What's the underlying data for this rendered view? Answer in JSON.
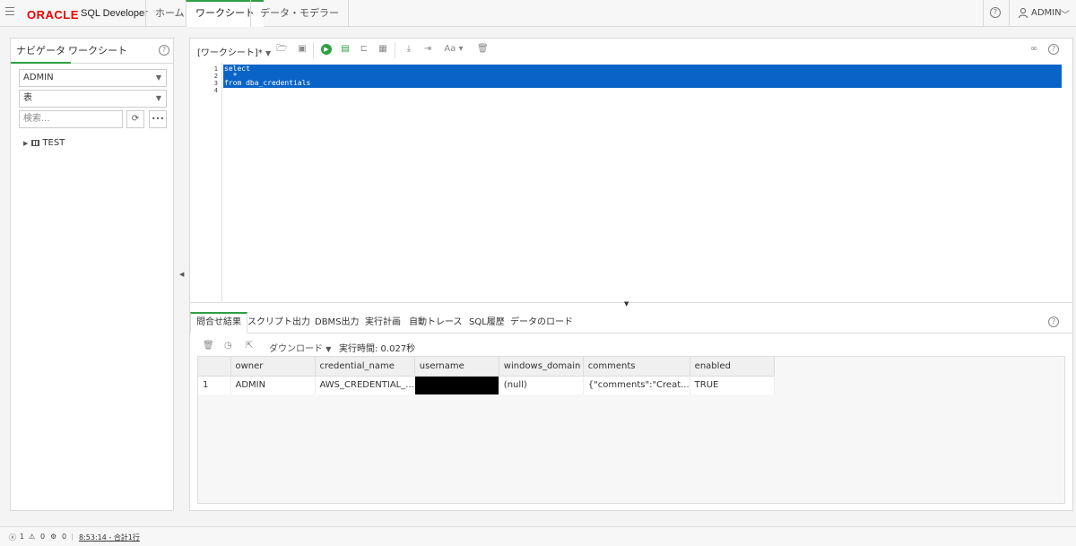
{
  "header": {
    "logo": "ORACLE",
    "product": "SQL Developer",
    "tabs": [
      "ホーム",
      "ワークシート",
      "データ・モデラー"
    ],
    "active_tab": "ワークシート",
    "help": "?",
    "user": "ADMIN"
  },
  "navigator": {
    "tabs": [
      "ナビゲータ",
      "ワークシート"
    ],
    "active_tab": "ナビゲータ",
    "help": "?",
    "schema": "ADMIN",
    "object_type": "表",
    "search_placeholder": "検索...",
    "more": "•••",
    "tree": [
      "TEST"
    ]
  },
  "worksheet": {
    "title": "[ワークシート]*",
    "line_numbers": [
      "1",
      "2",
      "3",
      "4"
    ],
    "code_lines": [
      "select",
      "  *",
      "from dba_credentials",
      ""
    ]
  },
  "results": {
    "tabs": [
      "問合せ結果",
      "スクリプト出力",
      "DBMS出力",
      "実行計画",
      "自動トレース",
      "SQL履歴",
      "データのロード"
    ],
    "active_tab": "問合せ結果",
    "help": "?",
    "download_label": "ダウンロード",
    "exec_time": "実行時間: 0.027秒",
    "columns": [
      "owner",
      "credential_name",
      "username",
      "windows_domain",
      "comments",
      "enabled"
    ],
    "rows": [
      {
        "num": "1",
        "owner": "ADMIN",
        "credential_name": "AWS_CREDENTIAL_...",
        "username": "",
        "windows_domain": "(null)",
        "comments": "{\"comments\":\"Creat...",
        "enabled": "TRUE"
      }
    ]
  },
  "status": {
    "errors": "1",
    "warnings": "0",
    "info": "0",
    "message": "8:53:14 - 合計1行"
  },
  "colors": {
    "accent": "#2ea043",
    "selection": "#0a64c8",
    "oracle_red": "#e00000"
  }
}
